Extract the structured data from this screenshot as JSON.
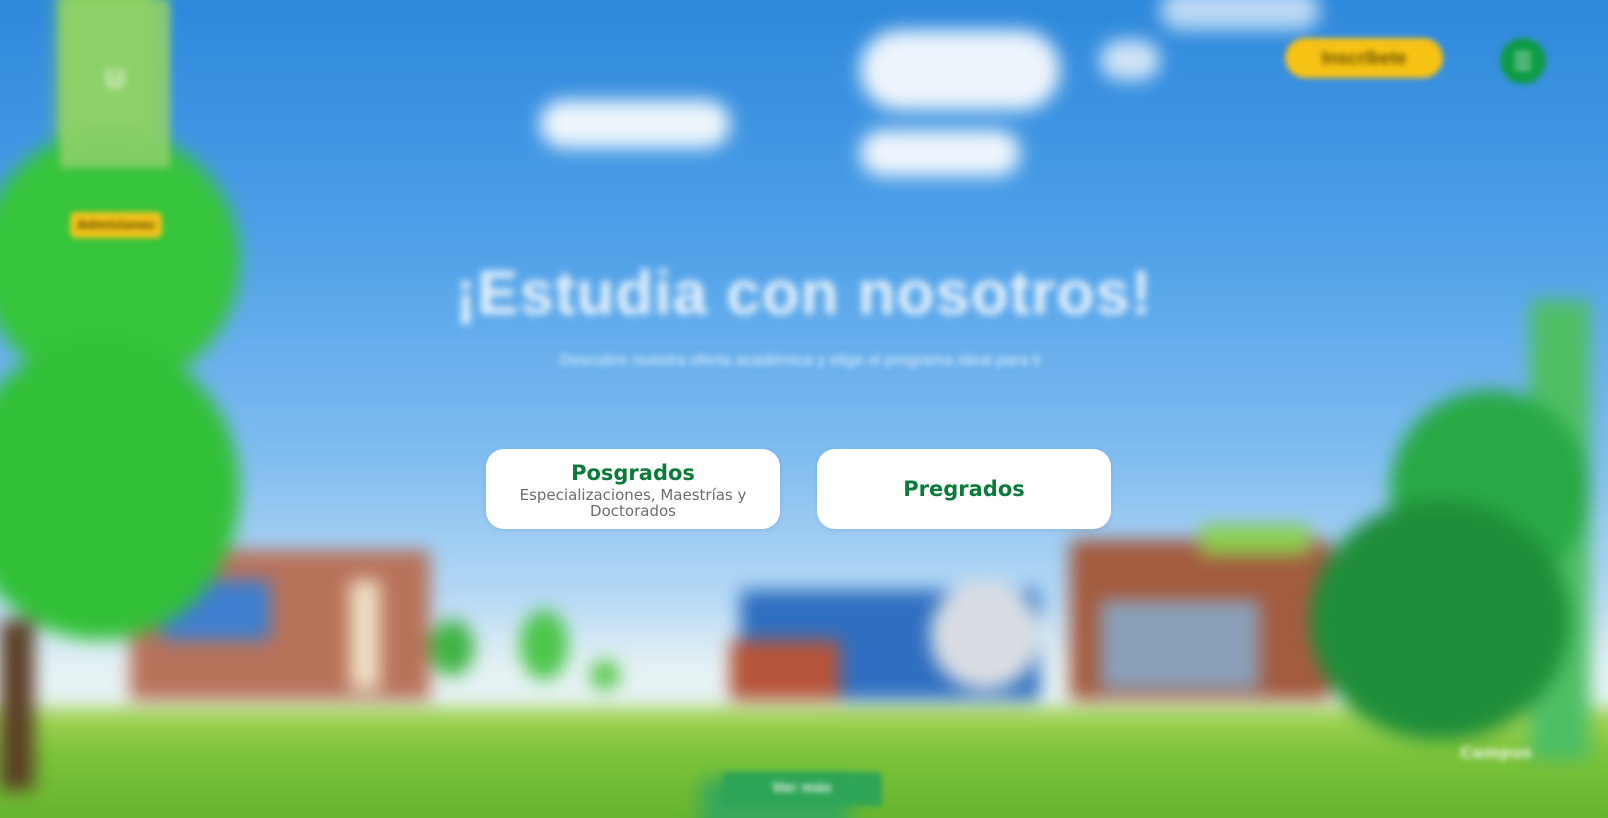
{
  "header": {
    "enroll_label": "Inscríbete",
    "menu_icon": "menu-icon"
  },
  "sidebar": {
    "logo_text": "U",
    "badge_label": "Admisiones"
  },
  "hero": {
    "title": "¡Estudia con nosotros!",
    "subtitle": "Descubre nuestra oferta académica y elige el programa ideal para ti"
  },
  "choices": [
    {
      "title": "Posgrados",
      "description": "Especializaciones, Maestrías y Doctorados"
    },
    {
      "title": "Pregrados",
      "description": ""
    }
  ],
  "footer": {
    "tab_label": "Ver más",
    "corner_logo_text": "Campus"
  },
  "colors": {
    "brand_green": "#0c7a3a",
    "accent_yellow": "#f6c213",
    "card_bg": "#ffffff",
    "sky": "#4ea0e8"
  }
}
